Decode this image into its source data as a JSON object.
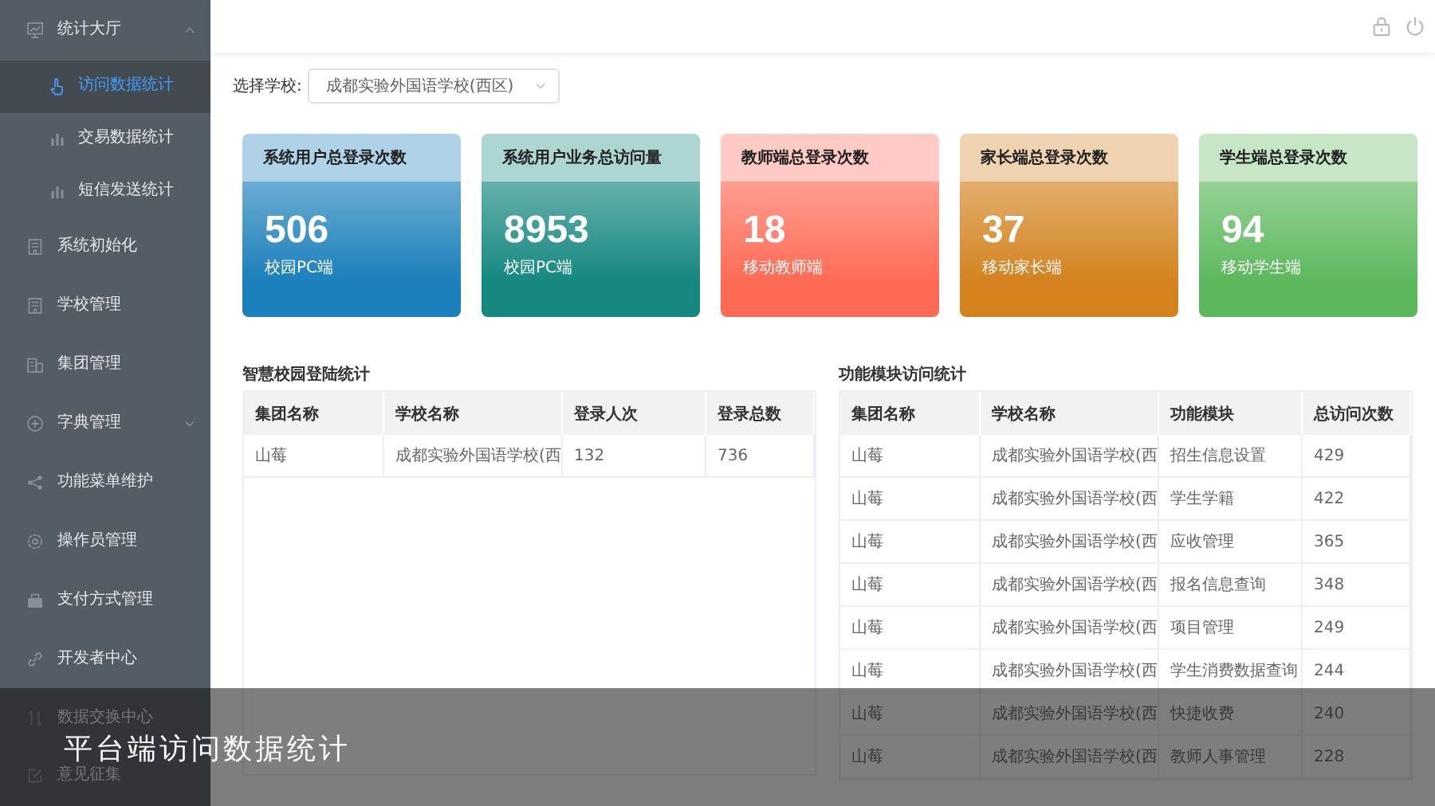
{
  "sidebar": {
    "items": [
      {
        "label": "统计大厅",
        "expanded": true,
        "selected": false,
        "children": [
          {
            "label": "访问数据统计",
            "selected": true
          },
          {
            "label": "交易数据统计",
            "selected": false
          },
          {
            "label": "短信发送统计",
            "selected": false
          }
        ]
      },
      {
        "label": "系统初始化",
        "selected": false
      },
      {
        "label": "学校管理",
        "selected": false
      },
      {
        "label": "集团管理",
        "selected": false
      },
      {
        "label": "字典管理",
        "expanded": false,
        "selected": false
      },
      {
        "label": "功能菜单维护",
        "selected": false
      },
      {
        "label": "操作员管理",
        "selected": false
      },
      {
        "label": "支付方式管理",
        "selected": false
      },
      {
        "label": "开发者中心",
        "selected": false
      },
      {
        "label": "数据交换中心",
        "selected": false
      },
      {
        "label": "意见征集",
        "selected": false
      }
    ]
  },
  "school_select": {
    "label": "选择学校:",
    "value": "成都实验外国语学校(西区)"
  },
  "cards": [
    {
      "title": "系统用户总登录次数",
      "value": "506",
      "caption": "校园PC端",
      "color": "#1a7fba"
    },
    {
      "title": "系统用户业务总访问量",
      "value": "8953",
      "caption": "校园PC端",
      "color": "#14877f"
    },
    {
      "title": "教师端总登录次数",
      "value": "18",
      "caption": "移动教师端",
      "color": "#ff6a55"
    },
    {
      "title": "家长端总登录次数",
      "value": "37",
      "caption": "移动家长端",
      "color": "#d3821e"
    },
    {
      "title": "学生端总登录次数",
      "value": "94",
      "caption": "移动学生端",
      "color": "#5cb85c"
    }
  ],
  "login_table": {
    "title": "智慧校园登陆统计",
    "columns": [
      "集团名称",
      "学校名称",
      "登录人次",
      "登录总数"
    ],
    "rows": [
      [
        "山莓",
        "成都实验外国语学校(西",
        "132",
        "736"
      ]
    ]
  },
  "module_table": {
    "title": "功能模块访问统计",
    "columns": [
      "集团名称",
      "学校名称",
      "功能模块",
      "总访问次数"
    ],
    "rows": [
      [
        "山莓",
        "成都实验外国语学校(西",
        "招生信息设置",
        "429"
      ],
      [
        "山莓",
        "成都实验外国语学校(西",
        "学生学籍",
        "422"
      ],
      [
        "山莓",
        "成都实验外国语学校(西",
        "应收管理",
        "365"
      ],
      [
        "山莓",
        "成都实验外国语学校(西",
        "报名信息查询",
        "348"
      ],
      [
        "山莓",
        "成都实验外国语学校(西",
        "项目管理",
        "249"
      ],
      [
        "山莓",
        "成都实验外国语学校(西",
        "学生消费数据查询",
        "244"
      ],
      [
        "山莓",
        "成都实验外国语学校(西",
        "快捷收费",
        "240"
      ],
      [
        "山莓",
        "成都实验外国语学校(西",
        "教师人事管理",
        "228"
      ]
    ]
  },
  "caption_banner": {
    "text": "平台端访问数据统计"
  }
}
